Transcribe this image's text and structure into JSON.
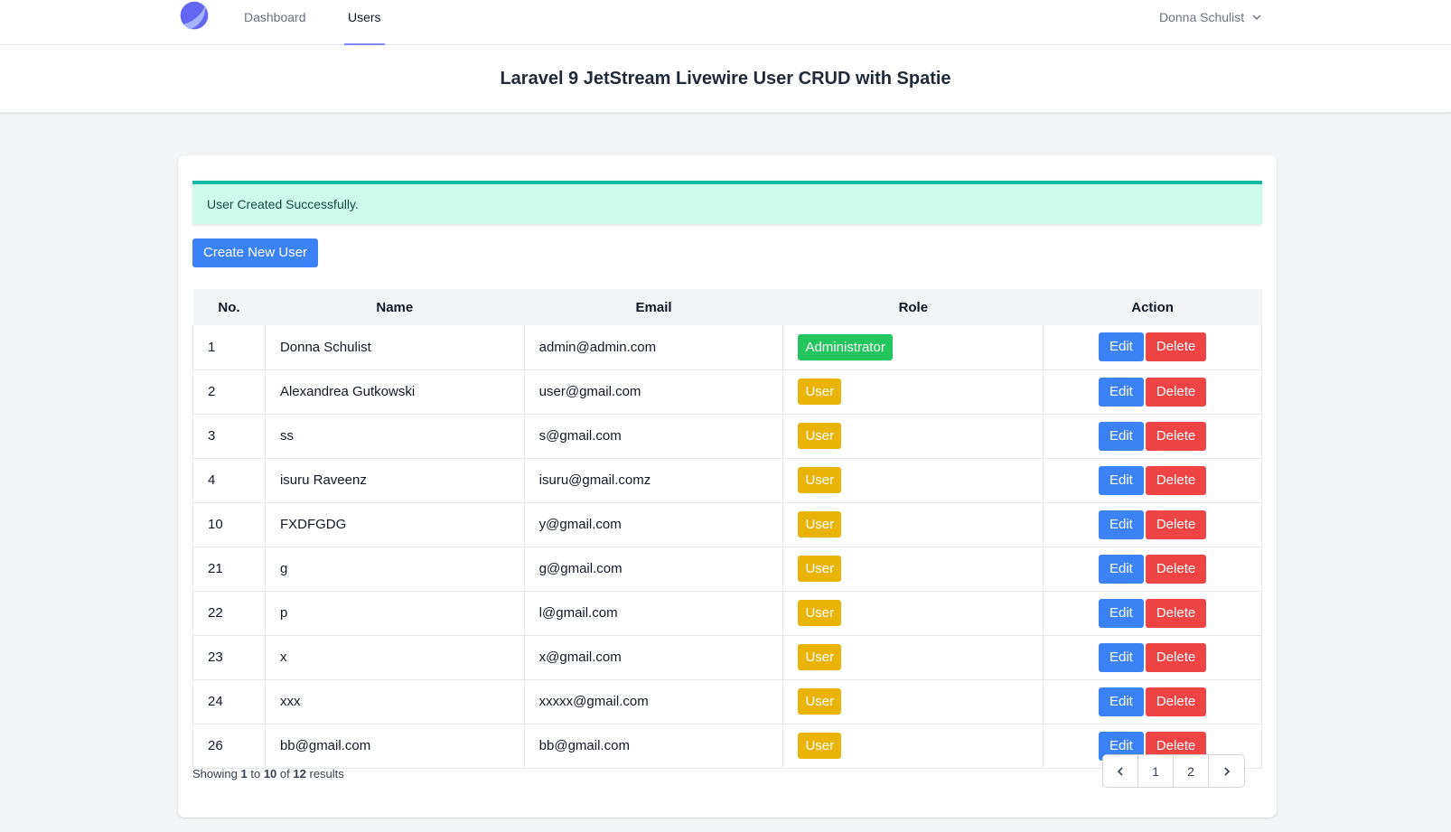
{
  "nav": {
    "links": [
      "Dashboard",
      "Users"
    ],
    "user_name": "Donna Schulist"
  },
  "header": {
    "title": "Laravel 9 JetStream Livewire User CRUD with Spatie"
  },
  "alert": {
    "message": "User Created Successfully."
  },
  "actions": {
    "create_label": "Create New User"
  },
  "table": {
    "headers": [
      "No.",
      "Name",
      "Email",
      "Role",
      "Action"
    ],
    "rows": [
      {
        "no": "1",
        "name": "Donna Schulist",
        "email": "admin@admin.com",
        "role": "Administrator"
      },
      {
        "no": "2",
        "name": "Alexandrea Gutkowski",
        "email": "user@gmail.com",
        "role": "User"
      },
      {
        "no": "3",
        "name": "ss",
        "email": "s@gmail.com",
        "role": "User"
      },
      {
        "no": "4",
        "name": "isuru Raveenz",
        "email": "isuru@gmail.comz",
        "role": "User"
      },
      {
        "no": "10",
        "name": "FXDFGDG",
        "email": "y@gmail.com",
        "role": "User"
      },
      {
        "no": "21",
        "name": "g",
        "email": "g@gmail.com",
        "role": "User"
      },
      {
        "no": "22",
        "name": "p",
        "email": "l@gmail.com",
        "role": "User"
      },
      {
        "no": "23",
        "name": "x",
        "email": "x@gmail.com",
        "role": "User"
      },
      {
        "no": "24",
        "name": "xxx",
        "email": "xxxxx@gmail.com",
        "role": "User"
      },
      {
        "no": "26",
        "name": "bb@gmail.com",
        "email": "bb@gmail.com",
        "role": "User"
      }
    ],
    "edit_label": "Edit",
    "delete_label": "Delete"
  },
  "pagination": {
    "showing_prefix": "Showing",
    "from": "1",
    "to_word": "to",
    "to": "10",
    "of_word": "of",
    "total": "12",
    "results_word": "results",
    "pages": [
      "1",
      "2"
    ]
  },
  "colors": {
    "primary": "#3b82f6",
    "danger": "#ef4444",
    "admin_badge": "#22c55e",
    "user_badge": "#eab308",
    "alert_bg": "#ccfbeb",
    "alert_border": "#14b8a6"
  }
}
